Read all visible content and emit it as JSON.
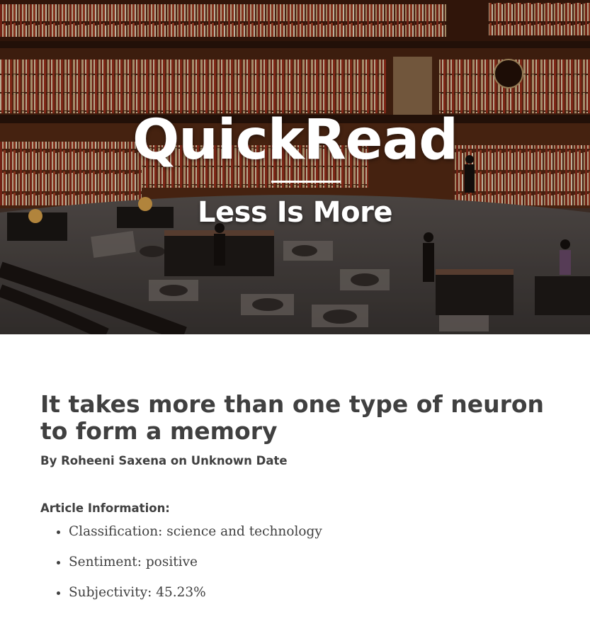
{
  "site": {
    "title": "QuickRead",
    "tagline": "Less Is More"
  },
  "article": {
    "title": "It takes more than one type of neuron to form a memory",
    "byline": "By Roheeni Saxena on Unknown Date",
    "info_heading": "Article Information:",
    "info_items": [
      "Classification: science and technology",
      "Sentiment: positive",
      "Subjectivity: 45.23%"
    ]
  },
  "colors": {
    "text": "#404040",
    "hero_text": "#ffffff"
  }
}
